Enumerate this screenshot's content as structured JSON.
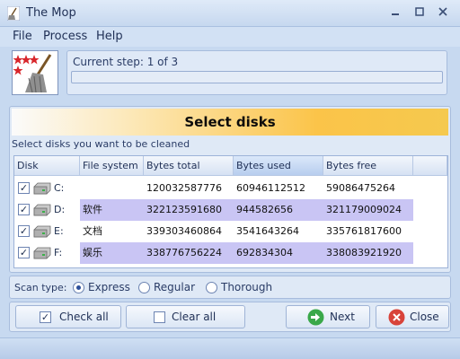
{
  "window": {
    "title": "The Mop"
  },
  "menu": {
    "items": [
      "File",
      "Process",
      "Help"
    ]
  },
  "step": {
    "text": "Current step: 1 of 3",
    "progress_fraction": 0
  },
  "section": {
    "heading": "Select disks",
    "instruction": "Select disks you want to be cleaned"
  },
  "table": {
    "columns": [
      "Disk",
      "File system",
      "Bytes total",
      "Bytes used",
      "Bytes free"
    ],
    "sorted_column": "Bytes used",
    "rows": [
      {
        "disk": "C:",
        "file_system": "",
        "bytes_total": "120032587776",
        "bytes_used": "60946112512",
        "bytes_free": "59086475264",
        "checked": true,
        "highlight": false
      },
      {
        "disk": "D:",
        "file_system": "软件",
        "bytes_total": "322123591680",
        "bytes_used": "944582656",
        "bytes_free": "321179009024",
        "checked": true,
        "highlight": true
      },
      {
        "disk": "E:",
        "file_system": "文档",
        "bytes_total": "339303460864",
        "bytes_used": "3541643264",
        "bytes_free": "335761817600",
        "checked": true,
        "highlight": false
      },
      {
        "disk": "F:",
        "file_system": "娱乐",
        "bytes_total": "338776756224",
        "bytes_used": "692834304",
        "bytes_free": "338083921920",
        "checked": true,
        "highlight": true
      }
    ]
  },
  "scan": {
    "label": "Scan type:",
    "options": [
      "Express",
      "Regular",
      "Thorough"
    ],
    "selected": "Express"
  },
  "buttons": {
    "check_all": "Check all",
    "clear_all": "Clear all",
    "next": "Next",
    "close": "Close"
  },
  "colors": {
    "window_bg": "#c7d9f0",
    "row_highlight": "#c9c5f4",
    "banner_accent": "#fbc449",
    "next_icon": "#3aa84a",
    "close_icon": "#d8433a"
  }
}
